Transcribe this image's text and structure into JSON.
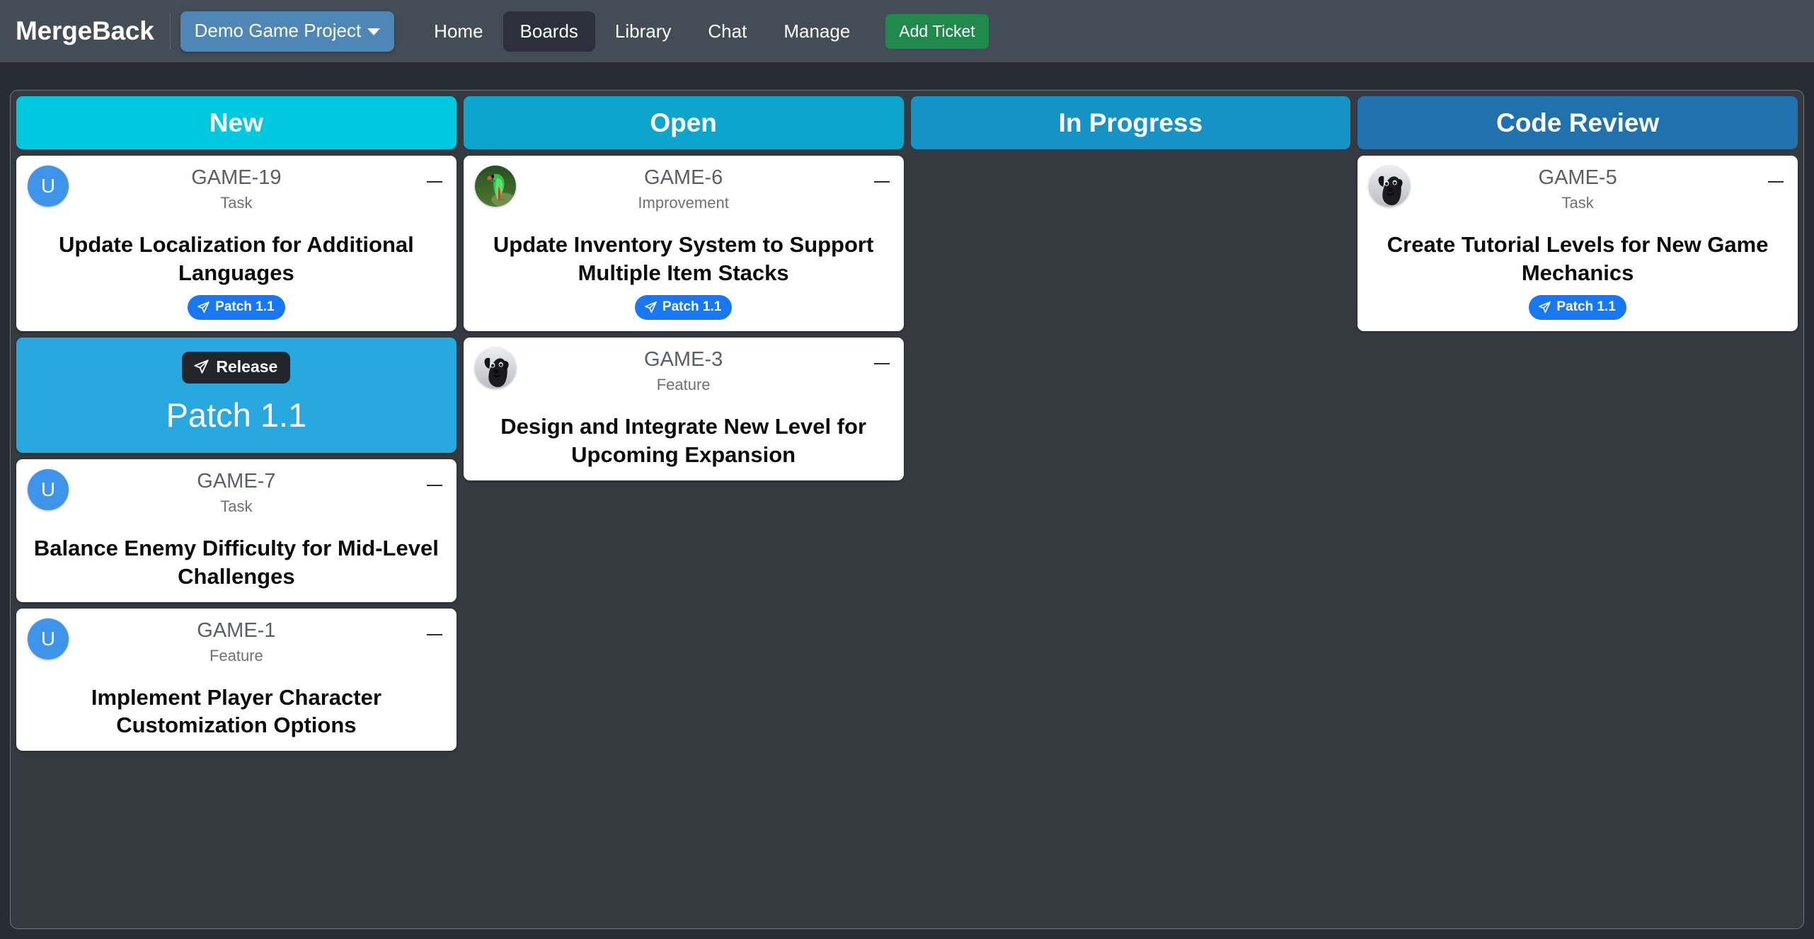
{
  "navbar": {
    "brand": "MergeBack",
    "project_selector": {
      "label": "Demo Game Project",
      "icon": "chevron-down-icon"
    },
    "links": [
      {
        "label": "Home",
        "active": false
      },
      {
        "label": "Boards",
        "active": true
      },
      {
        "label": "Library",
        "active": false
      },
      {
        "label": "Chat",
        "active": false
      },
      {
        "label": "Manage",
        "active": false
      }
    ],
    "add_ticket_label": "Add Ticket",
    "colors": {
      "navbar_bg": "#444c56",
      "project_bg": "#4e87b5",
      "active_link_bg": "#2b303a",
      "add_ticket_bg": "#1f8a4c"
    }
  },
  "board": {
    "columns": [
      {
        "title": "New",
        "header_color": "#00c8de",
        "cards": [
          {
            "kind": "ticket",
            "key": "GAME-19",
            "type": "Task",
            "title": "Update Localization for Additional Languages",
            "avatar": {
              "kind": "initial",
              "initial": "U",
              "color": "#3d94e8"
            },
            "release_badge": "Patch 1.1",
            "collapse_label": "−"
          },
          {
            "kind": "release",
            "pill_label": "Release",
            "name": "Patch 1.1",
            "color": "#29a8e0"
          },
          {
            "kind": "ticket",
            "key": "GAME-7",
            "type": "Task",
            "title": "Balance Enemy Difficulty for Mid-Level Challenges",
            "avatar": {
              "kind": "initial",
              "initial": "U",
              "color": "#3d94e8"
            },
            "release_badge": null,
            "collapse_label": "−"
          },
          {
            "kind": "ticket",
            "key": "GAME-1",
            "type": "Feature",
            "title": "Implement Player Character Customization Options",
            "avatar": {
              "kind": "initial",
              "initial": "U",
              "color": "#3d94e8"
            },
            "release_badge": null,
            "collapse_label": "−"
          }
        ]
      },
      {
        "title": "Open",
        "header_color": "#0ea5cd",
        "cards": [
          {
            "kind": "ticket",
            "key": "GAME-6",
            "type": "Improvement",
            "title": "Update Inventory System to Support Multiple Item Stacks",
            "avatar": {
              "kind": "photo",
              "photo": "green-parrot"
            },
            "release_badge": "Patch 1.1",
            "collapse_label": "−"
          },
          {
            "kind": "ticket",
            "key": "GAME-3",
            "type": "Feature",
            "title": "Design and Integrate New Level for Upcoming Expansion",
            "avatar": {
              "kind": "photo",
              "photo": "black-dog"
            },
            "release_badge": null,
            "collapse_label": "−"
          }
        ]
      },
      {
        "title": "In Progress",
        "header_color": "#1693c6",
        "cards": []
      },
      {
        "title": "Code Review",
        "header_color": "#1f72ae",
        "cards": [
          {
            "kind": "ticket",
            "key": "GAME-5",
            "type": "Task",
            "title": "Create Tutorial Levels for New Game Mechanics",
            "avatar": {
              "kind": "photo",
              "photo": "black-dog"
            },
            "release_badge": "Patch 1.1",
            "collapse_label": "−"
          }
        ]
      }
    ]
  }
}
